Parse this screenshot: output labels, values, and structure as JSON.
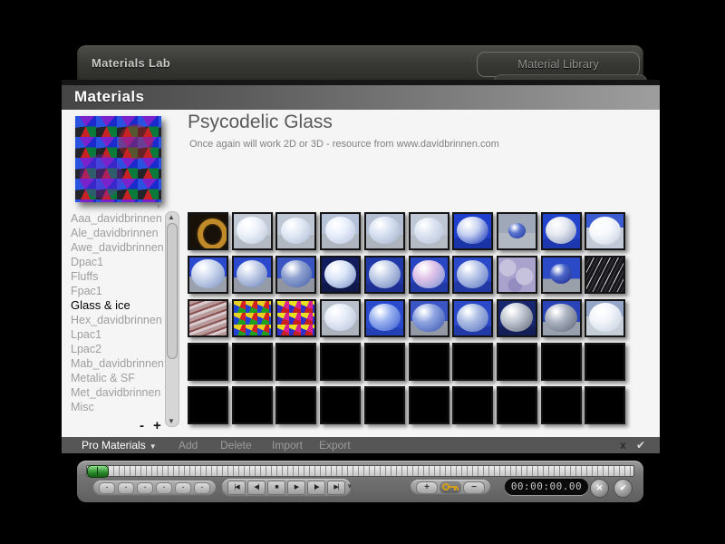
{
  "window": {
    "title": "Materials Lab",
    "library_button": "Material Library",
    "header": "Materials"
  },
  "detail": {
    "title": "Psycodelic Glass",
    "subtitle": "Once again will work 2D or 3D - resource from www.davidbrinnen.com"
  },
  "preview": {
    "chevron": "▼",
    "colors": [
      "#1a2acc",
      "#0a7a3a",
      "#c82222",
      "#23232a",
      "#7a22cc",
      "#2a52e0"
    ]
  },
  "category_list": {
    "items": [
      {
        "label": "Aaa_davidbrinnen",
        "selected": false
      },
      {
        "label": "Ale_davidbrinnen",
        "selected": false
      },
      {
        "label": "Awe_davidbrinnen",
        "selected": false
      },
      {
        "label": "Dpac1",
        "selected": false
      },
      {
        "label": "Fluffs",
        "selected": false
      },
      {
        "label": "Fpac1",
        "selected": false
      },
      {
        "label": "Glass & ice",
        "selected": true
      },
      {
        "label": "Hex_davidbrinnen",
        "selected": false
      },
      {
        "label": "Lpac1",
        "selected": false
      },
      {
        "label": "Lpac2",
        "selected": false
      },
      {
        "label": "Mab_davidbrinnen",
        "selected": false
      },
      {
        "label": "Metalic & SF",
        "selected": false
      },
      {
        "label": "Met_davidbrinnen",
        "selected": false
      },
      {
        "label": "Misc",
        "selected": false
      }
    ],
    "scroll_up": "▲",
    "scroll_down": "▼",
    "zoom_out": "-",
    "zoom_in": "+"
  },
  "bottom_bar": {
    "preset_label": "Pro Materials",
    "dropdown_arrow": "▼",
    "actions": [
      "Add",
      "Delete",
      "Import",
      "Export"
    ],
    "cancel_label": "x",
    "confirm_label": "✔"
  },
  "player": {
    "timecode": "00:00:00.00",
    "chevron": "▼",
    "memory_buttons": [
      "▪",
      "▪",
      "▪",
      "▪",
      "▪",
      "▪"
    ],
    "transport_buttons": [
      {
        "name": "skip-to-start",
        "glyph": "|◀"
      },
      {
        "name": "step-back",
        "glyph": "◀|"
      },
      {
        "name": "stop",
        "glyph": "■"
      },
      {
        "name": "play",
        "glyph": "▶"
      },
      {
        "name": "step-forward",
        "glyph": "|▶"
      },
      {
        "name": "skip-to-end",
        "glyph": "▶|"
      }
    ],
    "add_key_label": "+",
    "remove_key_label": "−",
    "cancel_glyph": "✕",
    "confirm_glyph": "✔",
    "slider_color": "#2a8a2a",
    "key_color": "#d4a017"
  },
  "grid": {
    "columns": 10,
    "rows": 5,
    "cells": [
      {
        "type": "torus",
        "bg": "#171109",
        "ring": "#c08a28",
        "ringDark": "#6a4410"
      },
      {
        "type": "sphere",
        "sky": "#c2cad6",
        "ground": "#b4bac4",
        "gy": 62,
        "s1": "#eef3fa",
        "s2": "#c6d0e0",
        "sz": 82
      },
      {
        "type": "sphere",
        "sky": "#bfc7d4",
        "ground": "#b2b8c2",
        "gy": 60,
        "s1": "#e2eaf6",
        "s2": "#bcc8dc",
        "sz": 80
      },
      {
        "type": "sphere",
        "sky": "#b6c2d8",
        "ground": "#b0b6c0",
        "gy": 58,
        "s1": "#eaf0fc",
        "s2": "#c2cee6",
        "sz": 82
      },
      {
        "type": "sphere",
        "sky": "#b4bed2",
        "ground": "#aeb4be",
        "gy": 60,
        "s1": "#d8e2f2",
        "s2": "#b0bcd4",
        "sz": 84
      },
      {
        "type": "sphere",
        "sky": "#c0c8d6",
        "ground": "#b6bcc6",
        "gy": 62,
        "s1": "#dce4f2",
        "s2": "#c0cade",
        "sz": 80
      },
      {
        "type": "sphere",
        "sky": "#1f3ecb",
        "ground": "#1a34a8",
        "gy": 70,
        "s1": "#c7d2f2",
        "s2": "#3c56c4",
        "sz": 84
      },
      {
        "type": "sphere",
        "sky": "#9fa8b8",
        "ground": "#b2b8c2",
        "gy": 55,
        "s1": "#5a74d0",
        "s2": "#2e46a8",
        "sz": 46
      },
      {
        "type": "sphere",
        "sky": "#2343cc",
        "ground": "#1d38ae",
        "gy": 72,
        "s1": "#e4e8f0",
        "s2": "#9aa6c4",
        "sz": 84
      },
      {
        "type": "sphere",
        "sky": "#3c5cd2",
        "ground": "#c2cad8",
        "gy": 40,
        "s1": "#f6f8fc",
        "s2": "#d2dae8",
        "sz": 86
      },
      {
        "type": "sphere",
        "sky": "#2a49ce",
        "ground": "#9aa1ac",
        "gy": 55,
        "s1": "#cdd8ee",
        "s2": "#8fa2cc",
        "sz": 88
      },
      {
        "type": "sphere",
        "sky": "#2a49ce",
        "ground": "#959ca8",
        "gy": 58,
        "s1": "#c2cee8",
        "s2": "#7e92c2",
        "sz": 84
      },
      {
        "type": "sphere",
        "sky": "#3a55c2",
        "ground": "#8f96a2",
        "gy": 60,
        "s1": "#8fa2d0",
        "s2": "#5870b4",
        "sz": 82
      },
      {
        "type": "sphere",
        "sky": "#131d5e",
        "ground": "#10184a",
        "gy": 75,
        "s1": "#dce6f8",
        "s2": "#8fa4d0",
        "sz": 86
      },
      {
        "type": "sphere",
        "sky": "#2138a8",
        "ground": "#1d2f92",
        "gy": 75,
        "s1": "#c2cfe8",
        "s2": "#8094c6",
        "sz": 86
      },
      {
        "type": "sphere",
        "sky": "#2846c4",
        "ground": "#223aa6",
        "gy": 72,
        "s1": "#e0c2e8",
        "s2": "#8f9ed8",
        "sz": 86
      },
      {
        "type": "sphere",
        "sky": "#2a48c8",
        "ground": "#2238a4",
        "gy": 70,
        "s1": "#b8c6e8",
        "s2": "#7288cc",
        "sz": 86
      },
      {
        "type": "texture",
        "mode": "clouds",
        "colors": [
          "#a8a2cc",
          "#c6c2de",
          "#938cc0"
        ]
      },
      {
        "type": "sphere",
        "sky": "#2a4ac8",
        "ground": "#9aa0aa",
        "gy": 62,
        "s1": "#4a66c8",
        "s2": "#27389a",
        "sz": 60
      },
      {
        "type": "texture",
        "mode": "marble",
        "colors": [
          "#16161a",
          "#3a3a42",
          "#c8c8cc"
        ]
      },
      {
        "type": "texture",
        "mode": "streaks",
        "colors": [
          "#b89a9a",
          "#8a5050",
          "#d8ccd0"
        ]
      },
      {
        "type": "texture",
        "mode": "mosaic",
        "colors": [
          "#d42020",
          "#20a020",
          "#2040d8",
          "#e8d020"
        ]
      },
      {
        "type": "texture",
        "mode": "mosaic",
        "colors": [
          "#d82090",
          "#c82020",
          "#3030c8",
          "#e8e020"
        ]
      },
      {
        "type": "sphere",
        "sky": "#b8c0cc",
        "ground": "#aeb4be",
        "gy": 55,
        "s1": "#e6ecf8",
        "s2": "#c2cce0",
        "sz": 84
      },
      {
        "type": "sphere",
        "sky": "#2a4ace",
        "ground": "#2340b4",
        "gy": 78,
        "s1": "#9ab2f0",
        "s2": "#5272d8",
        "sz": 84
      },
      {
        "type": "sphere",
        "sky": "#3c55c4",
        "ground": "#939aa6",
        "gy": 58,
        "s1": "#8ea4e0",
        "s2": "#4f68bc",
        "sz": 86
      },
      {
        "type": "sphere",
        "sky": "#2a48c8",
        "ground": "#223aa8",
        "gy": 72,
        "s1": "#aabce4",
        "s2": "#6c84c8",
        "sz": 86
      },
      {
        "type": "sphere",
        "sky": "#18266e",
        "ground": "#141f58",
        "gy": 75,
        "s1": "#c2c8d2",
        "s2": "#787f8e",
        "sz": 88
      },
      {
        "type": "sphere",
        "sky": "#2a44b8",
        "ground": "#98a0ae",
        "gy": 60,
        "s1": "#aab2c0",
        "s2": "#6f7888",
        "sz": 86
      },
      {
        "type": "sphere",
        "sky": "#94a6c8",
        "ground": "#c6ced8",
        "gy": 45,
        "s1": "#f2f5fa",
        "s2": "#cfd8e4",
        "sz": 88
      },
      {
        "type": "empty"
      },
      {
        "type": "empty"
      },
      {
        "type": "empty"
      },
      {
        "type": "empty"
      },
      {
        "type": "empty"
      },
      {
        "type": "empty"
      },
      {
        "type": "empty"
      },
      {
        "type": "empty"
      },
      {
        "type": "empty"
      },
      {
        "type": "empty"
      },
      {
        "type": "empty"
      },
      {
        "type": "empty"
      },
      {
        "type": "empty"
      },
      {
        "type": "empty"
      },
      {
        "type": "empty"
      },
      {
        "type": "empty"
      },
      {
        "type": "empty"
      },
      {
        "type": "empty"
      },
      {
        "type": "empty"
      },
      {
        "type": "empty"
      }
    ]
  }
}
